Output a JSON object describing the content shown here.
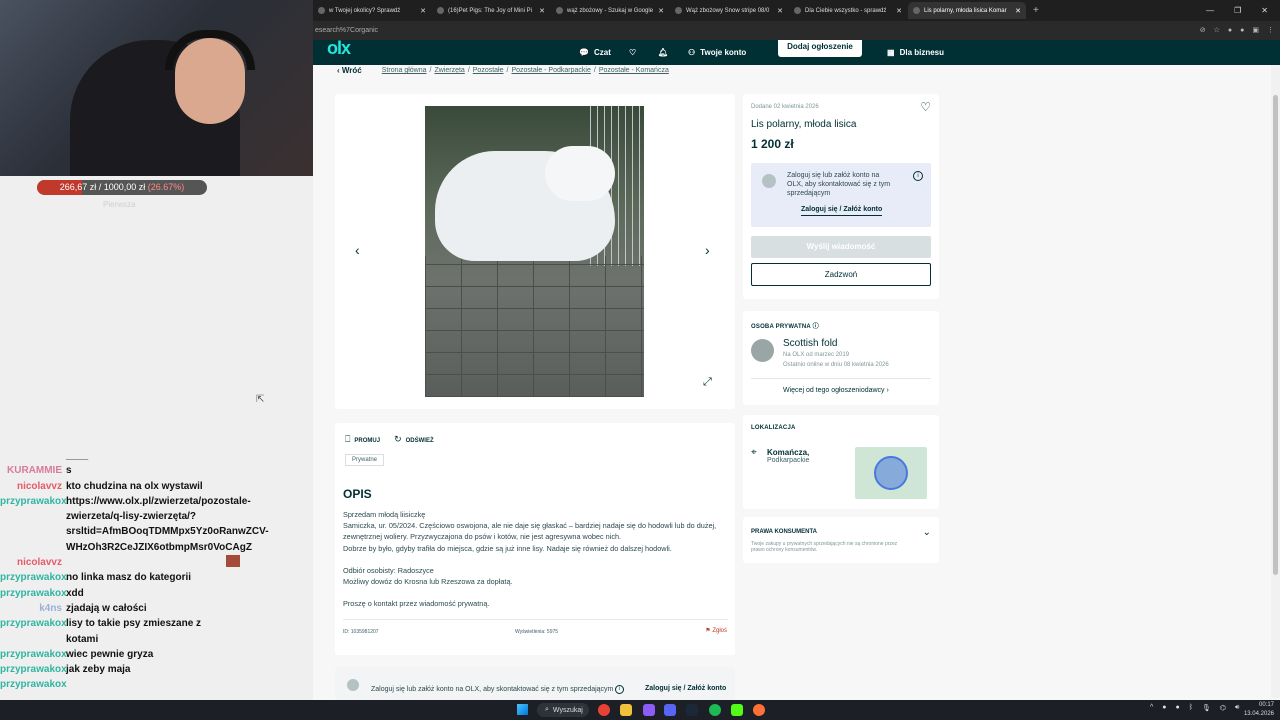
{
  "stream": {
    "goal_amount": "266,67 zł / 1000,00 zł",
    "goal_percent": "(26.67%)",
    "goal_fraction": 0.2667,
    "goal_subtitle": "Pierwsza"
  },
  "chat": [
    {
      "user": "",
      "message": "____",
      "color": "#444444"
    },
    {
      "user": "KURAMMIE",
      "message": "s",
      "color": "#d97a9e"
    },
    {
      "user": "nicolavvz",
      "message": "kto chudzina na olx wystawil",
      "color": "#e65a6a"
    },
    {
      "user": "przyprawakox",
      "message": "https://www.olx.pl/zwierzeta/pozostale-zwierzeta/q-lisy-zwierzęta/?srsltid=AfmBOoqTDMMpx5Yz0oRanwZCV-WHzOh3R2CeJZIX6otbmpMsr0VoCAgZ",
      "color": "#2fb5a0"
    },
    {
      "user": "nicolavvz",
      "message": "",
      "color": "#e65a6a",
      "emote": true
    },
    {
      "user": "przyprawakox",
      "message": "no linka masz do kategorii",
      "color": "#2fb5a0"
    },
    {
      "user": "przyprawakox",
      "message": "xdd",
      "color": "#2fb5a0"
    },
    {
      "user": "k4ns",
      "message": "zjadają w całości",
      "color": "#9ab0d8"
    },
    {
      "user": "przyprawakox",
      "message": "lisy to takie psy zmieszane z kotami",
      "color": "#2fb5a0"
    },
    {
      "user": "przyprawakox",
      "message": "wiec pewnie gryza",
      "color": "#2fb5a0"
    },
    {
      "user": "przyprawakox",
      "message": "jak zeby maja",
      "color": "#2fb5a0"
    },
    {
      "user": "przyprawakox",
      "message": "",
      "color": "#2fb5a0"
    }
  ],
  "browser": {
    "tabs": [
      {
        "label": "w Twojej okolicy? Sprawdź",
        "active": false
      },
      {
        "label": "(16)Pet Pigs: The Joy of Mini Pi",
        "active": false
      },
      {
        "label": "wąż zbożowy - Szukaj w Google",
        "active": false
      },
      {
        "label": "Wąż zbożowy Snow stripe 08/0",
        "active": false
      },
      {
        "label": "Dla Ciebie wszystko - sprawdź",
        "active": false
      },
      {
        "label": "Lis polarny, młoda lisica Komar",
        "active": true
      }
    ],
    "address": "esearch%7Corganic"
  },
  "olx": {
    "logo": "olx",
    "nav": {
      "chat": "Czat",
      "account": "Twoje konto",
      "post": "Dodaj ogłoszenie",
      "business": "Dla biznesu"
    },
    "back": "Wróć",
    "breadcrumb": [
      "Strona główna",
      "Zwierzęta",
      "Pozostałe",
      "Pozostałe - Podkarpackie",
      "Pozostałe - Komańcza"
    ],
    "ad": {
      "added": "Dodane 02 kwietnia 2026",
      "title": "Lis polarny, młoda lisica",
      "price": "1 200 zł",
      "login_prompt": "Zaloguj się lub załóż konto na OLX, aby skontaktować się z tym sprzedającym",
      "login_link": "Zaloguj się / Załóż konto",
      "send_message": "Wyślij wiadomość",
      "call": "Zadzwoń"
    },
    "seller": {
      "section": "OSOBA PRYWATNA",
      "name": "Scottish fold",
      "since": "Na OLX od marzec 2019",
      "online": "Ostatnio online w dniu 08 kwietnia 2026",
      "more": "Więcej od tego ogłoszeniodawcy"
    },
    "location": {
      "section": "LOKALIZACJA",
      "city": "Komańcza,",
      "region": "Podkarpackie"
    },
    "rights": {
      "section": "PRAWA KONSUMENTA",
      "text": "Twoje zakupy u prywatnych sprzedających nie są chronione przez prawo ochrony konsumentów."
    },
    "description": {
      "promote": "PROMUJ",
      "refresh": "ODŚWIEŻ",
      "tag": "Prywatne",
      "heading": "OPIS",
      "lines": [
        "Sprzedam młodą liisiczkę",
        "Samiczka, ur. 05/2024. Częściowo oswojona, ale nie daje się głaskać – bardziej nadaje się do hodowli lub do dużej, zewnętrznej woliery. Przyzwyczajona do psów i kotów, nie jest agresywna wobec nich.",
        "Dobrze by było, gdyby trafiła do miejsca, gdzie są już inne lisy. Nadaje się również do dalszej hodowli.",
        "",
        "Odbiór osobisty: Radoszyce",
        "Możliwy dowóz do Krosna lub Rzeszowa za dopłatą.",
        "",
        "Proszę o kontakt przez wiadomość prywatną."
      ],
      "id": "ID: 1035981207",
      "views": "Wyświetlenia: 5975",
      "report": "Zgłoś"
    },
    "bottom_prompt": "Zaloguj się lub załóż konto na OLX, aby skontaktować się z tym sprzedającym",
    "bottom_link": "Zaloguj się / Załóż konto"
  },
  "taskbar": {
    "search": "Wyszukaj",
    "time": "00:17",
    "date": "13.04.2026"
  }
}
